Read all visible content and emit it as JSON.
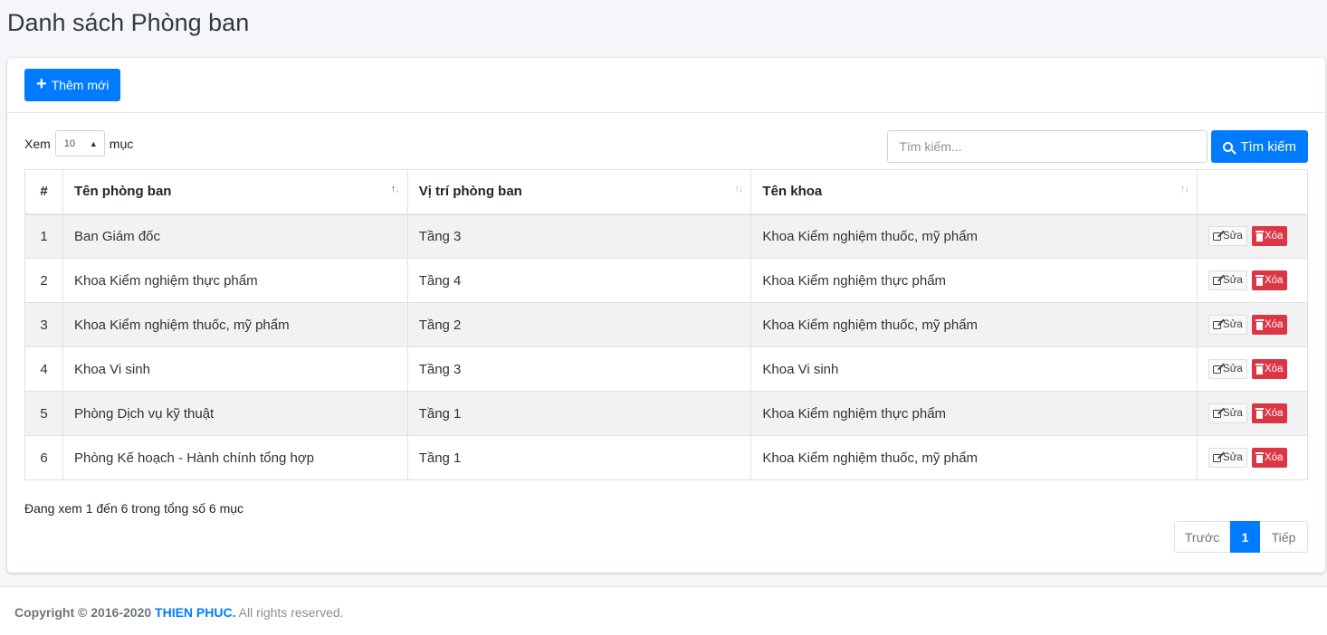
{
  "page": {
    "title": "Danh sách Phòng ban"
  },
  "header": {
    "add_label": "Thêm mới"
  },
  "length_menu": {
    "prefix": "Xem",
    "value": "10",
    "suffix": "mục"
  },
  "search": {
    "placeholder": "Tìm kiếm...",
    "button_label": "Tìm kiếm"
  },
  "table": {
    "columns": [
      "#",
      "Tên phòng ban",
      "Vị trí phòng ban",
      "Tên khoa",
      ""
    ],
    "rows": [
      {
        "num": "1",
        "name": "Ban Giám đốc",
        "location": "Tầng 3",
        "faculty": "Khoa Kiểm nghiệm thuốc, mỹ phẩm"
      },
      {
        "num": "2",
        "name": "Khoa Kiểm nghiệm thực phẩm",
        "location": "Tầng 4",
        "faculty": "Khoa Kiểm nghiệm thực phẩm"
      },
      {
        "num": "3",
        "name": "Khoa Kiểm nghiệm thuốc, mỹ phẩm",
        "location": "Tầng 2",
        "faculty": "Khoa Kiểm nghiệm thuốc, mỹ phẩm"
      },
      {
        "num": "4",
        "name": "Khoa Vi sinh",
        "location": "Tầng 3",
        "faculty": "Khoa Vi sinh"
      },
      {
        "num": "5",
        "name": "Phòng Dịch vụ kỹ thuật",
        "location": "Tầng 1",
        "faculty": "Khoa Kiểm nghiệm thực phẩm"
      },
      {
        "num": "6",
        "name": "Phòng Kế hoạch - Hành chính tổng hợp",
        "location": "Tầng 1",
        "faculty": "Khoa Kiểm nghiệm thuốc, mỹ phẩm"
      }
    ],
    "edit_label": "Sửa",
    "delete_label": "Xóa"
  },
  "info": {
    "text": "Đang xem 1 đến 6 trong tổng số 6 mục"
  },
  "pagination": {
    "prev": "Trước",
    "current": "1",
    "next": "Tiếp"
  },
  "footer": {
    "copyright": "Copyright © 2016-2020",
    "brand": "THIEN PHUC.",
    "rights": "All rights reserved."
  },
  "colors": {
    "primary": "#007bff",
    "danger": "#dc3545",
    "background": "#f4f6f9"
  }
}
